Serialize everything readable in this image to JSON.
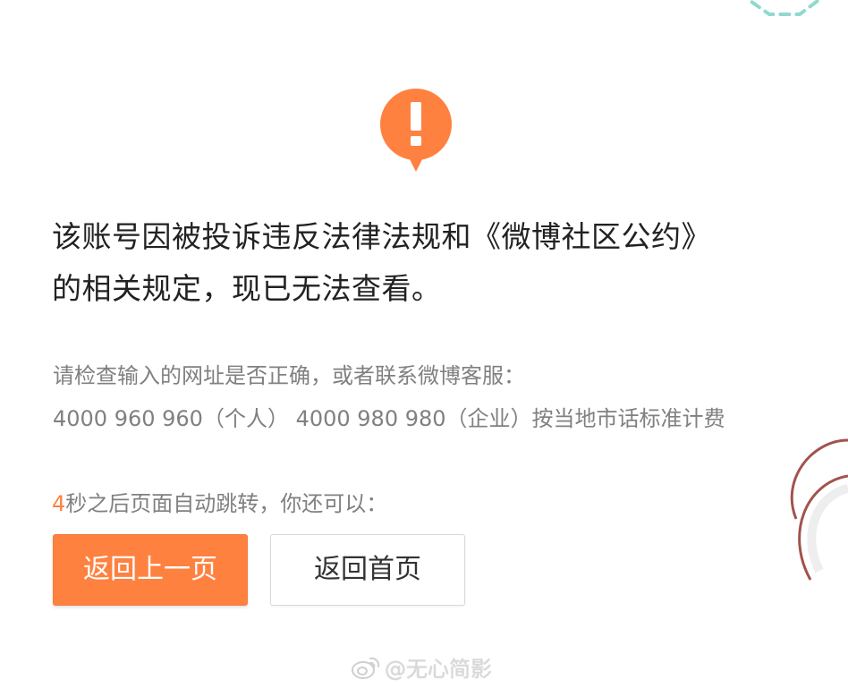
{
  "colors": {
    "accent": "#ff8140",
    "headline_text": "#222222",
    "hint_text": "#808080",
    "deco_green": "#8fd9cf",
    "deco_brown": "#a0544d"
  },
  "icons": {
    "warning": "exclamation-speech-bubble-icon",
    "watermark": "weibo-logo-icon"
  },
  "message": {
    "line1": "该账号因被投诉违反法律法规和《微博社区公约》",
    "line2": "的相关规定，现已无法查看。"
  },
  "help": {
    "line1": "请检查输入的网址是否正确，或者联系微博客服：",
    "line2": "4000 960 960（个人） 4000 980 980（企业）按当地市话标准计费"
  },
  "redirect": {
    "seconds": "4",
    "text": "秒之后页面自动跳转，你还可以："
  },
  "buttons": {
    "back": "返回上一页",
    "home": "返回首页"
  },
  "watermark": {
    "text": "@无心简影"
  }
}
